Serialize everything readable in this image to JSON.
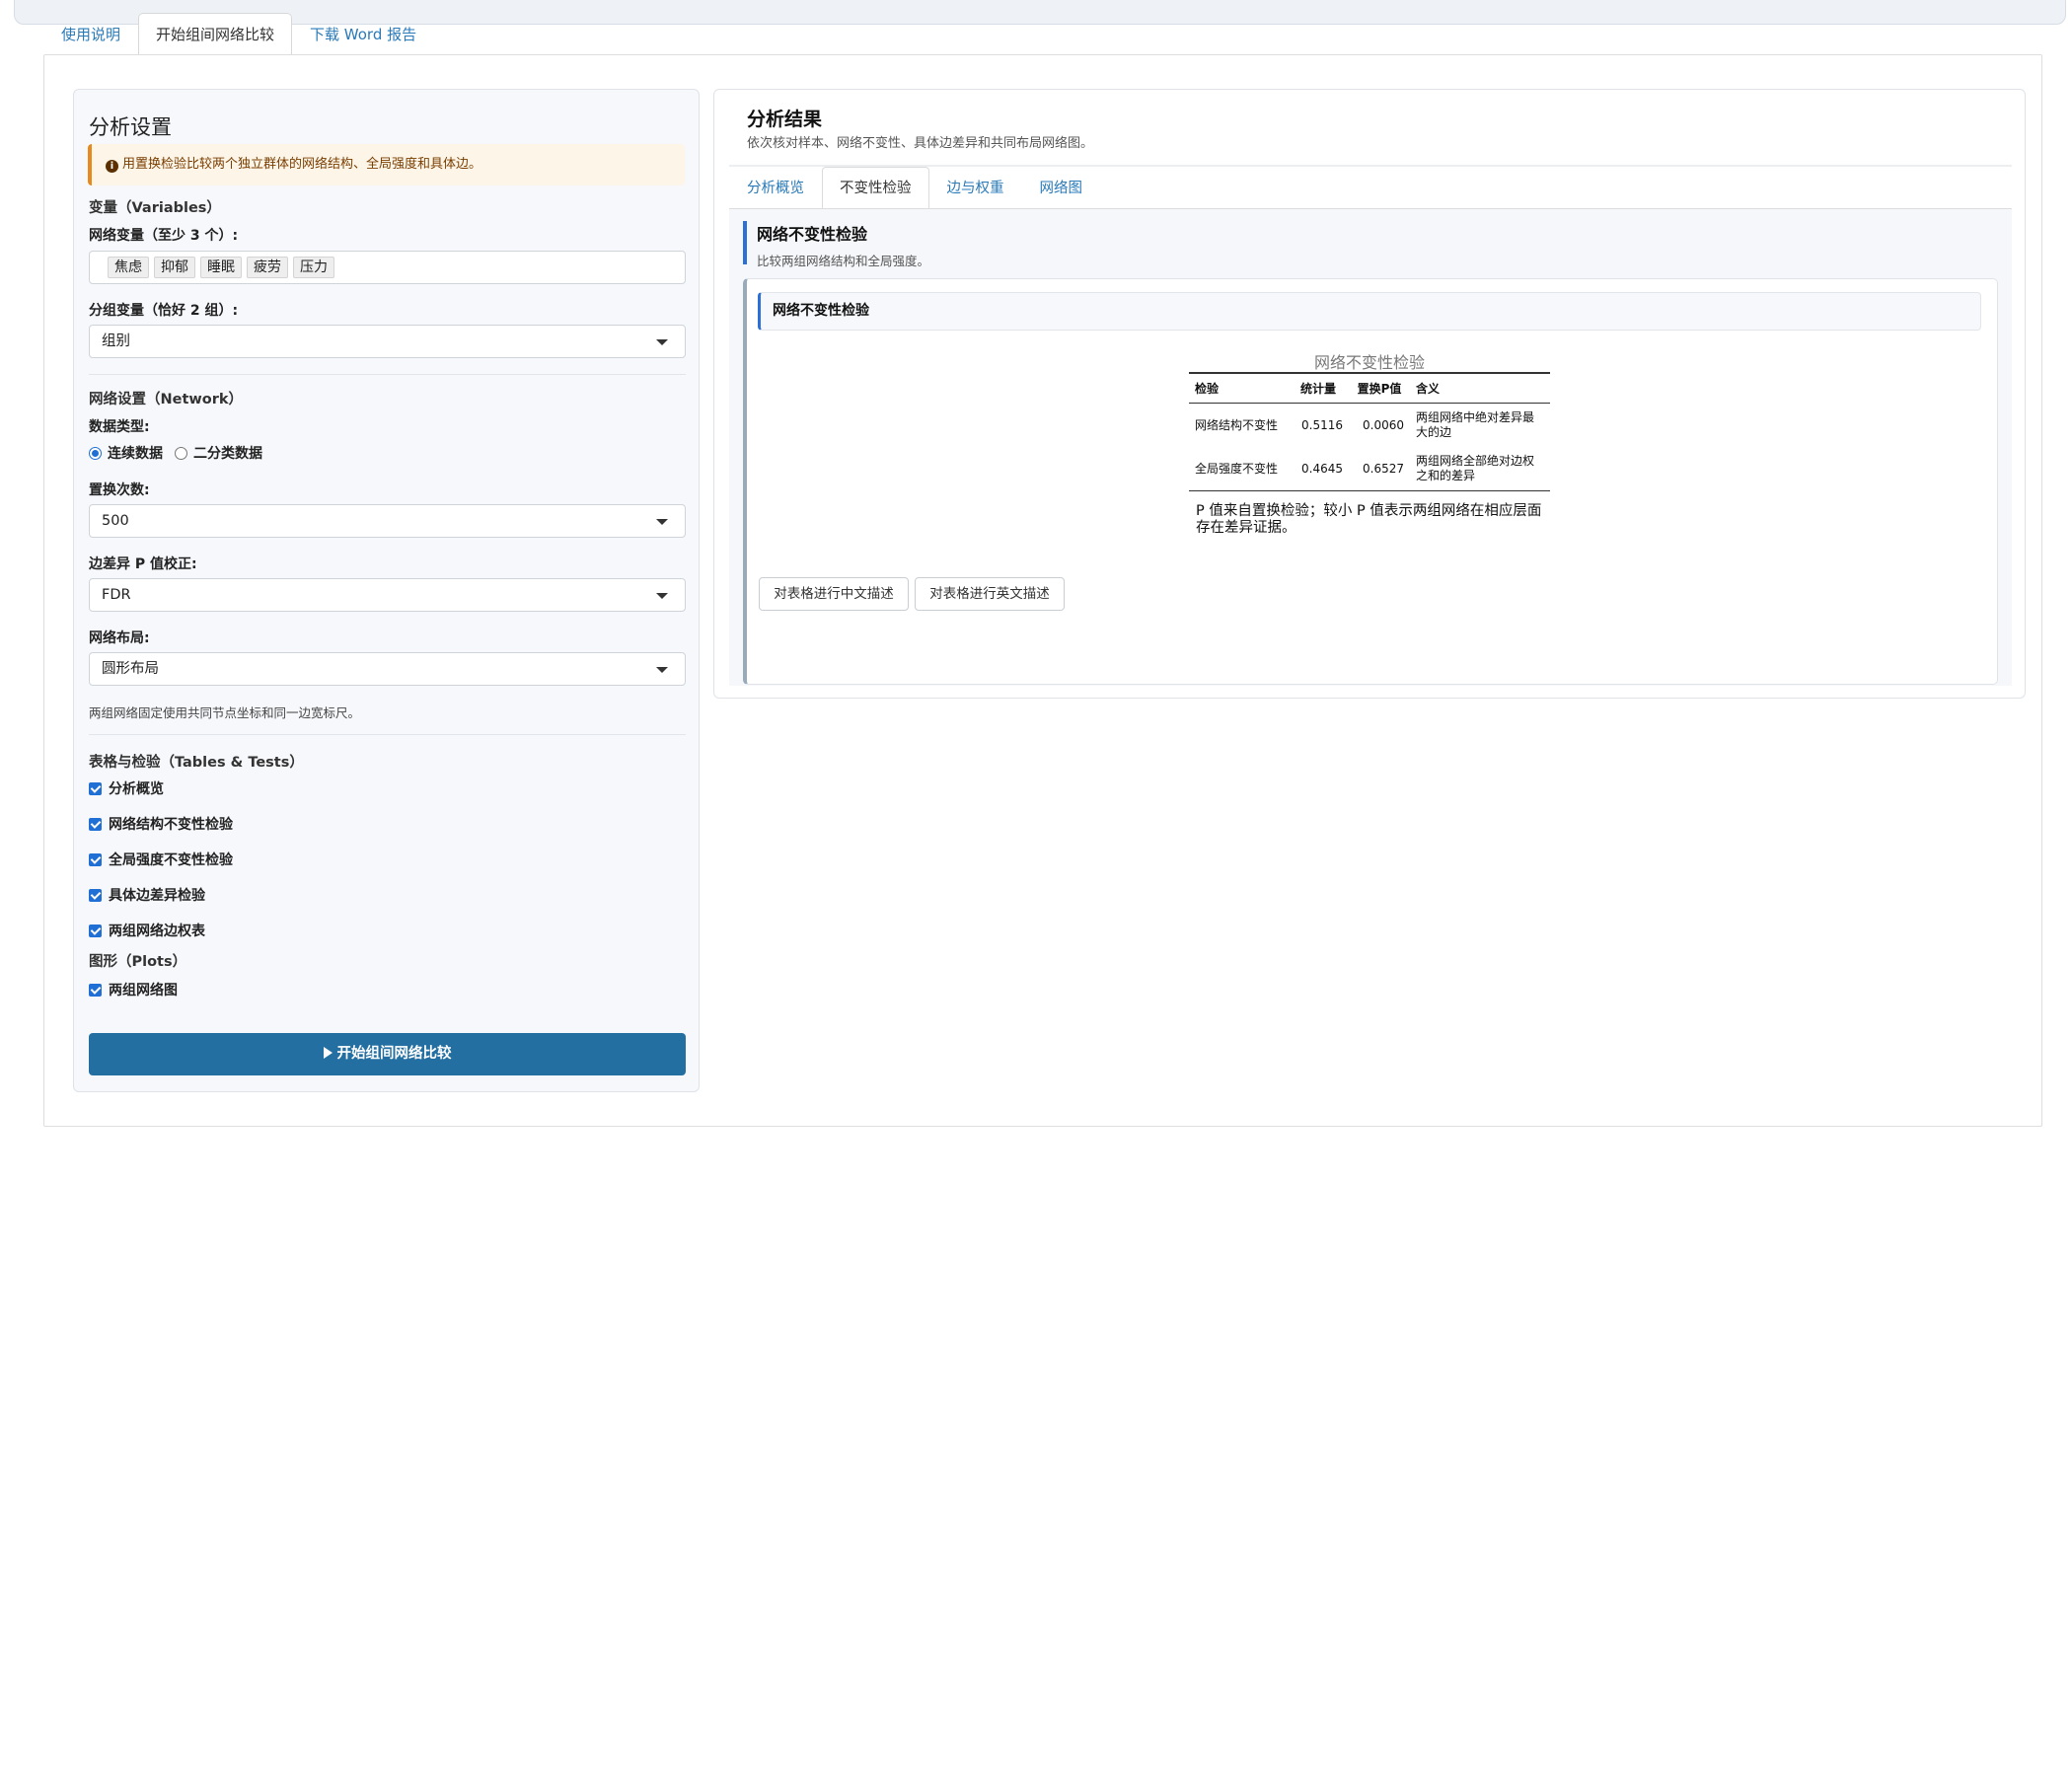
{
  "main_tabs": [
    {
      "label": "使用说明",
      "active": false
    },
    {
      "label": "开始组间网络比较",
      "active": true
    },
    {
      "label": "下载 Word 报告",
      "active": false
    }
  ],
  "settings": {
    "title": "分析设置",
    "alert": "用置换检验比较两个独立群体的网络结构、全局强度和具体边。",
    "variables_section": "变量（Variables）",
    "network_vars_label": "网络变量（至少 3 个）:",
    "network_vars": [
      "焦虑",
      "抑郁",
      "睡眠",
      "疲劳",
      "压力"
    ],
    "group_var_label": "分组变量（恰好 2 组）:",
    "group_var_value": "组别",
    "network_section": "网络设置（Network）",
    "data_type_label": "数据类型:",
    "data_type_options": [
      "连续数据",
      "二分类数据"
    ],
    "data_type_selected": "连续数据",
    "permutations_label": "置换次数:",
    "permutations_value": "500",
    "p_adjust_label": "边差异 P 值校正:",
    "p_adjust_value": "FDR",
    "layout_label": "网络布局:",
    "layout_value": "圆形布局",
    "layout_hint": "两组网络固定使用共同节点坐标和同一边宽标尺。",
    "tables_section": "表格与检验（Tables & Tests）",
    "tables_checks": [
      "分析概览",
      "网络结构不变性检验",
      "全局强度不变性检验",
      "具体边差异检验",
      "两组网络边权表"
    ],
    "plots_section": "图形（Plots）",
    "plots_checks": [
      "两组网络图"
    ],
    "run_button": "开始组间网络比较"
  },
  "results": {
    "title": "分析结果",
    "subtitle": "依次核对样本、网络不变性、具体边差异和共同布局网络图。",
    "tabs": [
      {
        "label": "分析概览",
        "active": false
      },
      {
        "label": "不变性检验",
        "active": true
      },
      {
        "label": "边与权重",
        "active": false
      },
      {
        "label": "网络图",
        "active": false
      }
    ],
    "section_title": "网络不变性检验",
    "section_subtitle": "比较两组网络结构和全局强度。",
    "card_title": "网络不变性检验",
    "table": {
      "caption": "网络不变性检验",
      "headers": [
        "检验",
        "统计量",
        "置换P值",
        "含义"
      ],
      "rows": [
        {
          "test": "网络结构不变性",
          "stat": "0.5116",
          "p": "0.0060",
          "meaning": "两组网络中绝对差异最大的边"
        },
        {
          "test": "全局强度不变性",
          "stat": "0.4645",
          "p": "0.6527",
          "meaning": "两组网络全部绝对边权之和的差异"
        }
      ],
      "note": "P 值来自置换检验；较小 P 值表示两组网络在相应层面存在差异证据。"
    },
    "buttons": {
      "describe_cn": "对表格进行中文描述",
      "describe_en": "对表格进行英文描述"
    }
  },
  "colors": {
    "primary_button": "#236fa1",
    "link": "#2a7ab8",
    "accent_blue": "#2c6fd6",
    "alert_border": "#e68a1e"
  }
}
